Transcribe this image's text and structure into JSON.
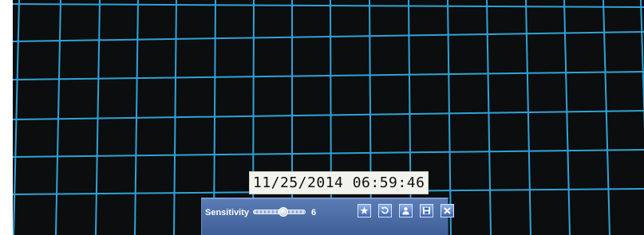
{
  "camera_view": {
    "background_color": "#0c0d0e",
    "grid_color": "#2fa3d8"
  },
  "timestamp": {
    "text": "11/25/2014 06:59:46"
  },
  "toolbar": {
    "sensitivity_label": "Sensitivity",
    "sensitivity_value": "6",
    "sensitivity_level_fraction": 0.6,
    "buttons": [
      {
        "name": "star-icon"
      },
      {
        "name": "refresh-icon"
      },
      {
        "name": "user-icon"
      },
      {
        "name": "save-icon"
      },
      {
        "name": "close-icon"
      }
    ]
  }
}
